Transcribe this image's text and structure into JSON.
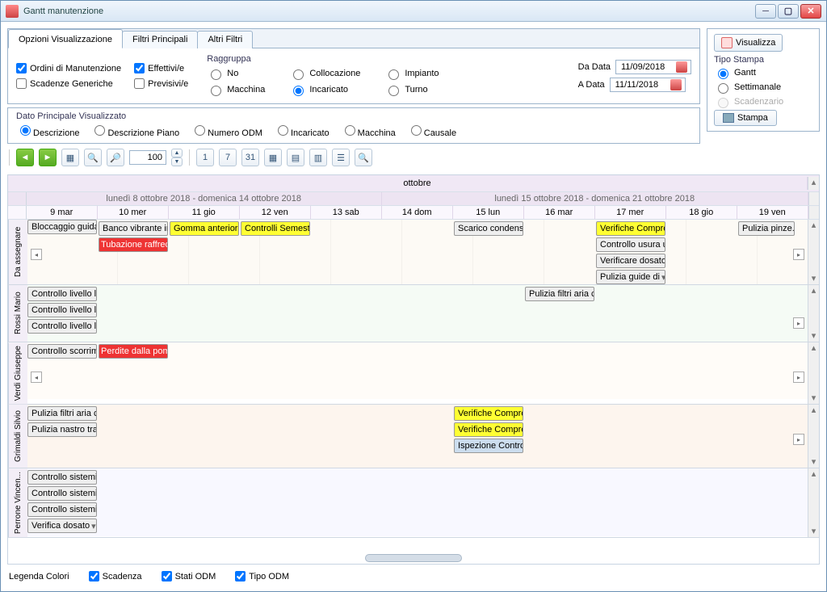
{
  "window": {
    "title": "Gantt manutenzione"
  },
  "tabs": {
    "t1": "Opzioni Visualizzazione",
    "t2": "Filtri Principali",
    "t3": "Altri Filtri"
  },
  "filters": {
    "ordini": "Ordini di Manutenzione",
    "scadenze": "Scadenze Generiche",
    "effettivi": "Effettivi/e",
    "previsivi": "Previsivi/e",
    "raggruppa": "Raggruppa",
    "no": "No",
    "macchina": "Macchina",
    "collocazione": "Collocazione",
    "incaricato": "Incaricato",
    "impianto": "Impianto",
    "turno": "Turno",
    "dadata": "Da Data",
    "adata": "A Data",
    "dadata_v": "11/09/2018",
    "adata_v": "11/11/2018"
  },
  "side": {
    "visualizza": "Visualizza",
    "tipostampa": "Tipo Stampa",
    "gantt": "Gantt",
    "settimanale": "Settimanale",
    "scadenzario": "Scadenzario",
    "stampa": "Stampa"
  },
  "dato": {
    "title": "Dato Principale Visualizzato",
    "descrizione": "Descrizione",
    "descpiano": "Descrizione Piano",
    "numodm": "Numero ODM",
    "incaricato": "Incaricato",
    "macchina": "Macchina",
    "causale": "Causale"
  },
  "zoom": "100",
  "hdr": {
    "month": "ottobre",
    "week1": "lunedì 8 ottobre 2018 - domenica 14 ottobre 2018",
    "week2": "lunedì 15 ottobre 2018 - domenica 21 ottobre 2018",
    "days": [
      "9 mar",
      "10 mer",
      "11 gio",
      "12 ven",
      "13 sab",
      "14 dom",
      "15 lun",
      "16 mar",
      "17 mer",
      "18 gio",
      "19 ven"
    ]
  },
  "rows": {
    "r0": "Da assegnare",
    "r1": "Rossi Mario",
    "r2": "Verdi Giuseppe",
    "r3": "Grimaldi Silvio",
    "r4": "Perrone Vincen..."
  },
  "tasks": {
    "t01": "Bloccaggio guida a",
    "t02": "Banco vibrante in",
    "t03": "Gomma anteriore",
    "t04": "Controlli Semestr",
    "t05": "Tubazione raffrecc",
    "t06": "Scarico condensa",
    "t07": "Verifiche Compre",
    "t08": "Pulizia pinze.",
    "t09": "Controllo usura u",
    "t10": "Verificare dosato",
    "t11": "Pulizia guide di",
    "t12": "Controllo livello li",
    "t13": "Controllo livello li",
    "t14": "Controllo livello li",
    "t15": "Pulizia filtri aria c",
    "t16": "Controllo scorrim",
    "t17": "Perdite dalla pom",
    "t18": "Pulizia filtri aria c",
    "t19": "Pulizia nastro tra",
    "t20": "Verifiche Compre",
    "t21": "Verifiche Compre",
    "t22": "Ispezione Contro",
    "t23": "Controllo sistemi",
    "t24": "Controllo sistemi",
    "t25": "Controllo sistemi",
    "t26": "Verifica dosato"
  },
  "legend": {
    "title": "Legenda Colori",
    "scad": "Scadenza",
    "stati": "Stati ODM",
    "tipo": "Tipo ODM"
  }
}
